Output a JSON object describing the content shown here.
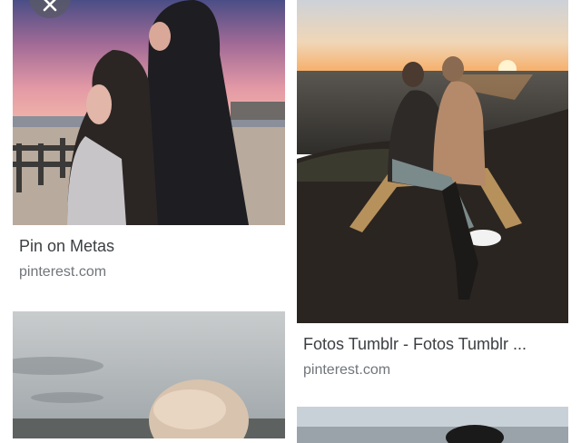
{
  "results": [
    {
      "title": "Pin on Metas",
      "source": "pinterest.com"
    },
    {
      "title": "Fotos Tumblr - Fotos Tumblr ...",
      "source": "pinterest.com"
    }
  ],
  "icons": {
    "close": "close-icon"
  }
}
